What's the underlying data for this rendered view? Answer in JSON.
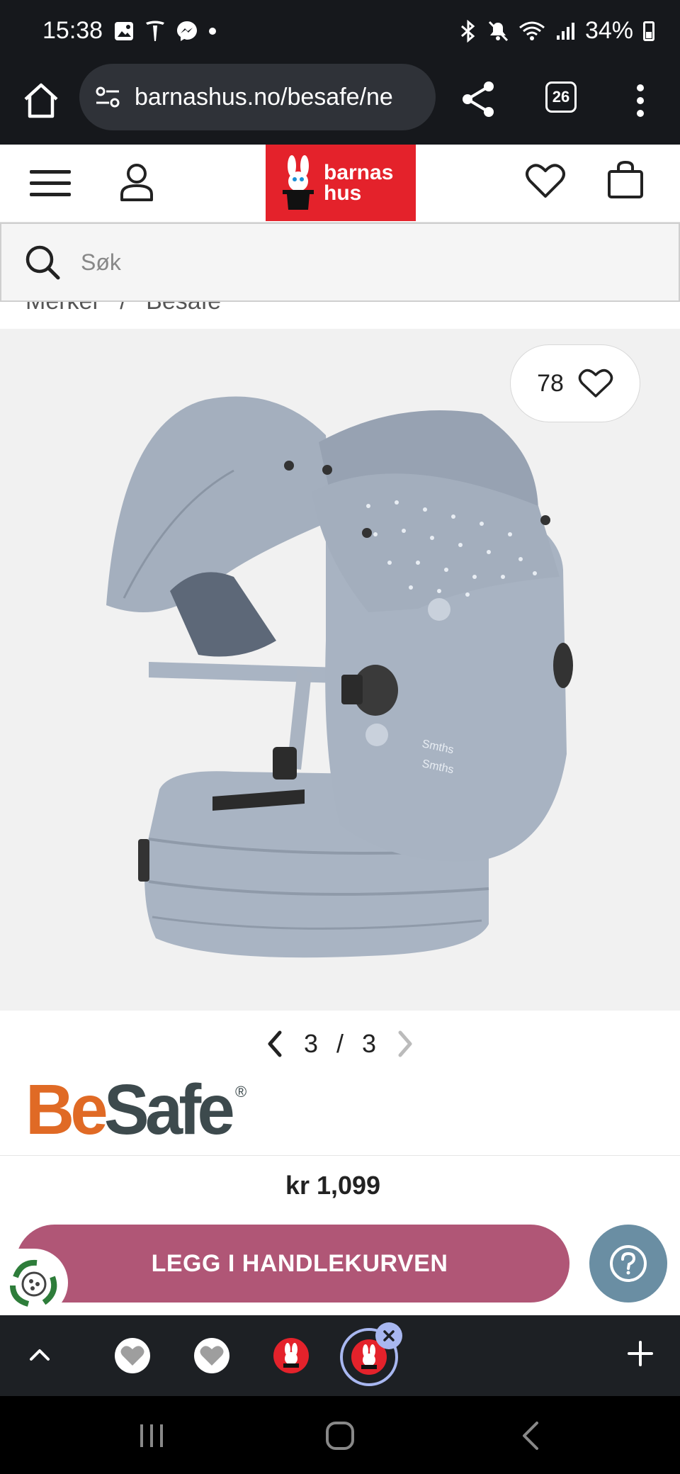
{
  "status_bar": {
    "time": "15:38",
    "battery": "34%",
    "icons": [
      "image-icon",
      "tesla-icon",
      "messenger-icon",
      "dot-icon",
      "bluetooth-icon",
      "mute-icon",
      "wifi-icon",
      "signal-icon",
      "battery-icon"
    ]
  },
  "browser": {
    "url": "barnashus.no/besafe/ne",
    "tab_count": "26"
  },
  "header": {
    "logo_line1": "barnas",
    "logo_line2": "hus",
    "logo_color": "#e4222b"
  },
  "search": {
    "placeholder": "Søk"
  },
  "breadcrumb": [
    "Merker",
    "/",
    "Besafe"
  ],
  "product": {
    "favorite_count": "78",
    "image_index": "3",
    "image_separator": "/",
    "image_total": "3",
    "brand": "BeSafe",
    "brand_registered": "®",
    "price": "kr 1,099",
    "add_to_cart_label": "LEGG I HANDLEKURVEN",
    "cart_button_color": "#b05676",
    "help_button_color": "#6a8ea3"
  },
  "tab_strip": {
    "tabs": [
      {
        "icon": "heart-tab-icon",
        "active": false
      },
      {
        "icon": "heart-tab-icon",
        "active": false
      },
      {
        "icon": "barnashus-rabbit-icon",
        "active": false
      },
      {
        "icon": "barnashus-rabbit-icon",
        "active": true
      }
    ]
  }
}
